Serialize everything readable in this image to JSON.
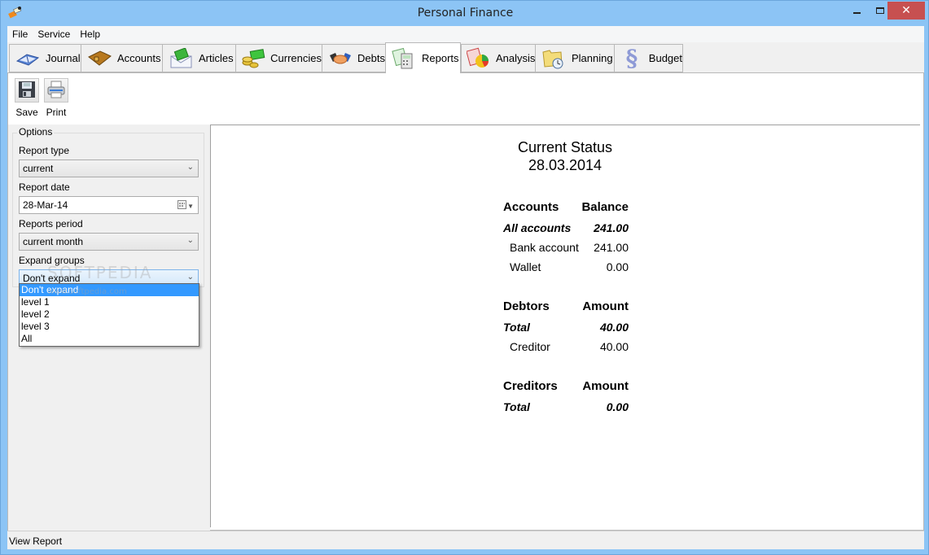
{
  "window": {
    "title": "Personal Finance",
    "minimize_label": "—",
    "maximize_label": "☐",
    "close_label": "✕"
  },
  "menu": {
    "items": [
      {
        "label": "File"
      },
      {
        "label": "Service"
      },
      {
        "label": "Help"
      }
    ]
  },
  "tabs": [
    {
      "label": "Journal",
      "icon": "book-icon"
    },
    {
      "label": "Accounts",
      "icon": "wallet-icon"
    },
    {
      "label": "Articles",
      "icon": "envelope-money-icon"
    },
    {
      "label": "Currencies",
      "icon": "coins-icon"
    },
    {
      "label": "Debts",
      "icon": "handshake-icon"
    },
    {
      "label": "Reports",
      "icon": "calculator-report-icon",
      "active": true
    },
    {
      "label": "Analysis",
      "icon": "pie-chart-icon"
    },
    {
      "label": "Planning",
      "icon": "folder-clock-icon"
    },
    {
      "label": "Budget",
      "icon": "section-sign-icon"
    }
  ],
  "toolbar": {
    "save_label": "Save",
    "print_label": "Print"
  },
  "options": {
    "legend": "Options",
    "report_type_label": "Report type",
    "report_type_value": "current",
    "report_date_label": "Report date",
    "report_date_value": "28-Mar-14",
    "reports_period_label": "Reports period",
    "reports_period_value": "current month",
    "expand_groups_label": "Expand groups",
    "expand_groups_value": "Don't expand",
    "expand_groups_options": [
      "Don't expand",
      "level 1",
      "level 2",
      "level 3",
      "All"
    ]
  },
  "watermark": {
    "brand": "SOFTPEDIA",
    "url": "www.softpedia.com"
  },
  "report": {
    "title": "Current Status",
    "date": "28.03.2014",
    "sections": [
      {
        "header": [
          "Accounts",
          "Balance"
        ],
        "total": [
          "All accounts",
          "241.00"
        ],
        "items": [
          [
            "Bank account",
            "241.00"
          ],
          [
            "Wallet",
            "0.00"
          ]
        ]
      },
      {
        "header": [
          "Debtors",
          "Amount"
        ],
        "total": [
          "Total",
          "40.00"
        ],
        "items": [
          [
            "Creditor",
            "40.00"
          ]
        ]
      },
      {
        "header": [
          "Creditors",
          "Amount"
        ],
        "total": [
          "Total",
          "0.00"
        ],
        "items": []
      }
    ]
  },
  "status": {
    "text": "View Report"
  }
}
